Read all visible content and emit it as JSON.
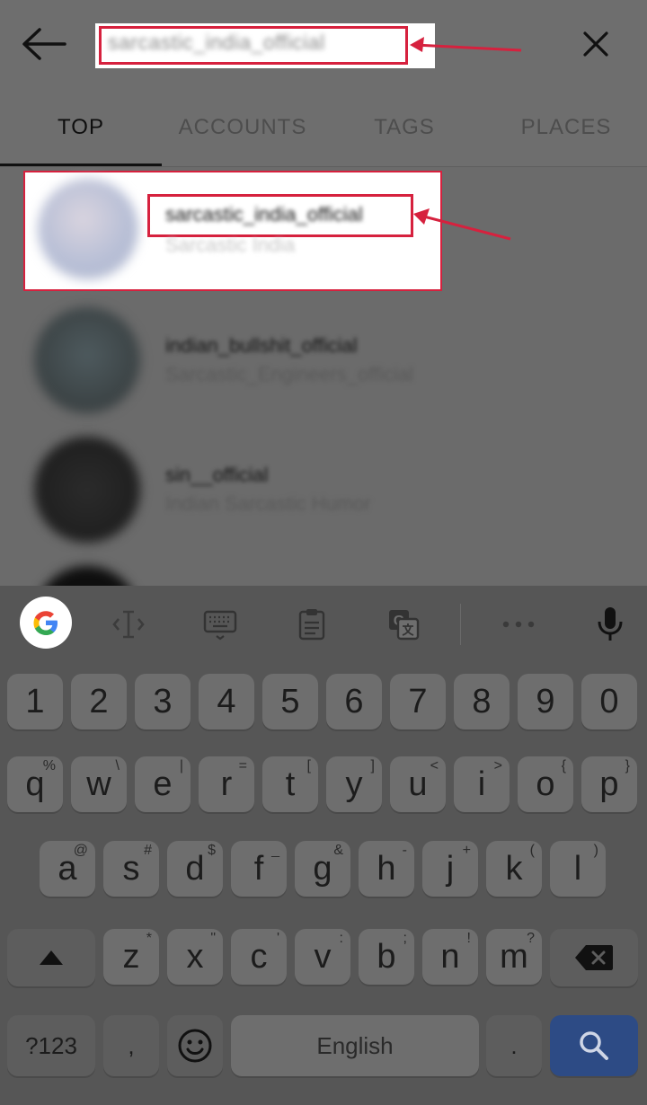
{
  "search": {
    "query": "sarcastic_india_official"
  },
  "tabs": [
    {
      "label": "TOP"
    },
    {
      "label": "ACCOUNTS"
    },
    {
      "label": "TAGS"
    },
    {
      "label": "PLACES"
    }
  ],
  "results": [
    {
      "username": "sarcastic_india_official",
      "full_name": "Sarcastic India"
    },
    {
      "username": "indian_bullshit_official",
      "full_name": "Sarcastic_Engineers_official"
    },
    {
      "username": "sin__official",
      "full_name": "Indian Sarcastic Humor"
    }
  ],
  "keyboard": {
    "number_row": [
      "1",
      "2",
      "3",
      "4",
      "5",
      "6",
      "7",
      "8",
      "9",
      "0"
    ],
    "row1": [
      {
        "key": "q",
        "sub": "%"
      },
      {
        "key": "w",
        "sub": "\\"
      },
      {
        "key": "e",
        "sub": "|"
      },
      {
        "key": "r",
        "sub": "="
      },
      {
        "key": "t",
        "sub": "["
      },
      {
        "key": "y",
        "sub": "]"
      },
      {
        "key": "u",
        "sub": "<"
      },
      {
        "key": "i",
        "sub": ">"
      },
      {
        "key": "o",
        "sub": "{"
      },
      {
        "key": "p",
        "sub": "}"
      }
    ],
    "row2": [
      {
        "key": "a",
        "sub": "@"
      },
      {
        "key": "s",
        "sub": "#"
      },
      {
        "key": "d",
        "sub": "$"
      },
      {
        "key": "f",
        "sub": "_"
      },
      {
        "key": "g",
        "sub": "&"
      },
      {
        "key": "h",
        "sub": "-"
      },
      {
        "key": "j",
        "sub": "+"
      },
      {
        "key": "k",
        "sub": "("
      },
      {
        "key": "l",
        "sub": ")"
      }
    ],
    "row3": [
      {
        "key": "z",
        "sub": "*"
      },
      {
        "key": "x",
        "sub": "\""
      },
      {
        "key": "c",
        "sub": "'"
      },
      {
        "key": "v",
        "sub": ":"
      },
      {
        "key": "b",
        "sub": ";"
      },
      {
        "key": "n",
        "sub": "!"
      },
      {
        "key": "m",
        "sub": "?"
      }
    ],
    "symbols_label": "?123",
    "comma": ",",
    "space_label": "English",
    "period": "."
  },
  "colors": {
    "highlight": "#d6213e",
    "search_key": "#2d4b85"
  },
  "icons": [
    "back-arrow-icon",
    "close-icon",
    "google-icon",
    "cursor-icon",
    "keyboard-icon",
    "clipboard-icon",
    "translate-icon",
    "more-icon",
    "microphone-icon",
    "shift-icon",
    "backspace-icon",
    "emoji-icon",
    "search-icon"
  ]
}
